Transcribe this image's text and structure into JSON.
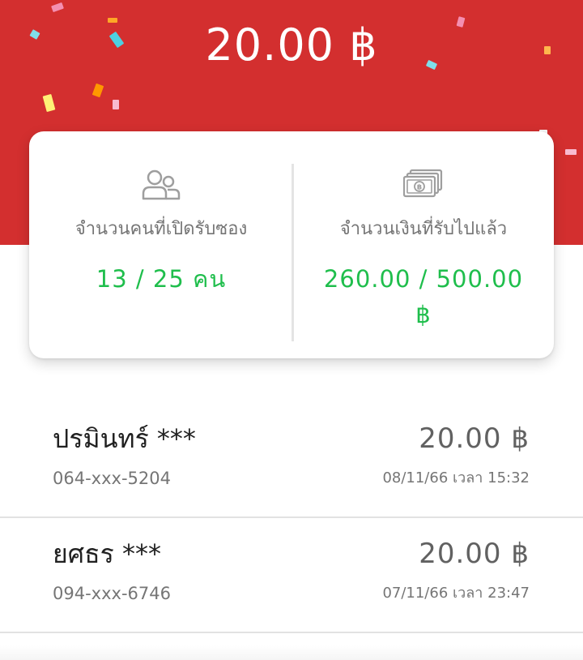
{
  "header": {
    "amount": "20.00 ฿",
    "background_color": "#d32f2f"
  },
  "stray_glyph": "",
  "stats": {
    "people": {
      "icon": "people-icon",
      "label": "จำนวนคนที่เปิดรับซอง",
      "value": "13 / 25 คน"
    },
    "money": {
      "icon": "banknote-icon",
      "label": "จำนวนเงินที่รับไปแล้ว",
      "value": "260.00 / 500.00 ฿"
    },
    "value_color": "#1fbe4c"
  },
  "transactions": [
    {
      "name": "ปรมินทร์ ***",
      "phone": "064-xxx-5204",
      "amount": "20.00 ฿",
      "datetime": "08/11/66 เวลา 15:32"
    },
    {
      "name": "ยศธร ***",
      "phone": "094-xxx-6746",
      "amount": "20.00 ฿",
      "datetime": "07/11/66 เวลา 23:47"
    }
  ]
}
